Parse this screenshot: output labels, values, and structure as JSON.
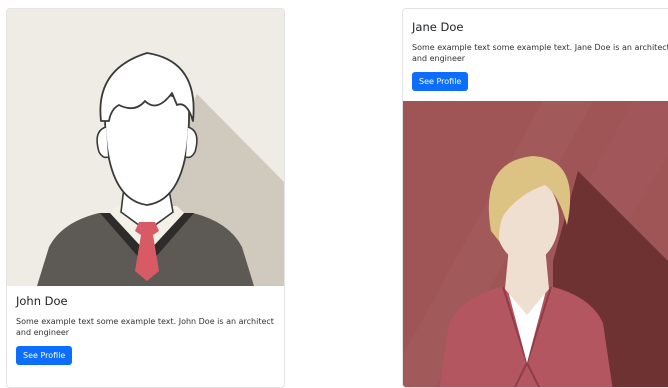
{
  "cards": [
    {
      "name": "John Doe",
      "text": "Some example text some example text. John Doe is an architect and engineer",
      "button_label": "See Profile"
    },
    {
      "name": "Jane Doe",
      "text": "Some example text some example text. Jane Doe is an architect and engineer",
      "button_label": "See Profile"
    }
  ],
  "colors": {
    "button_bg": "#0d6efd",
    "john_background": "#efece5",
    "john_shadow": "#cfcabd",
    "jane_background": "#9f5556",
    "jane_shadow": "#6e3232"
  },
  "icons": [
    "male-avatar-icon",
    "female-avatar-icon"
  ]
}
